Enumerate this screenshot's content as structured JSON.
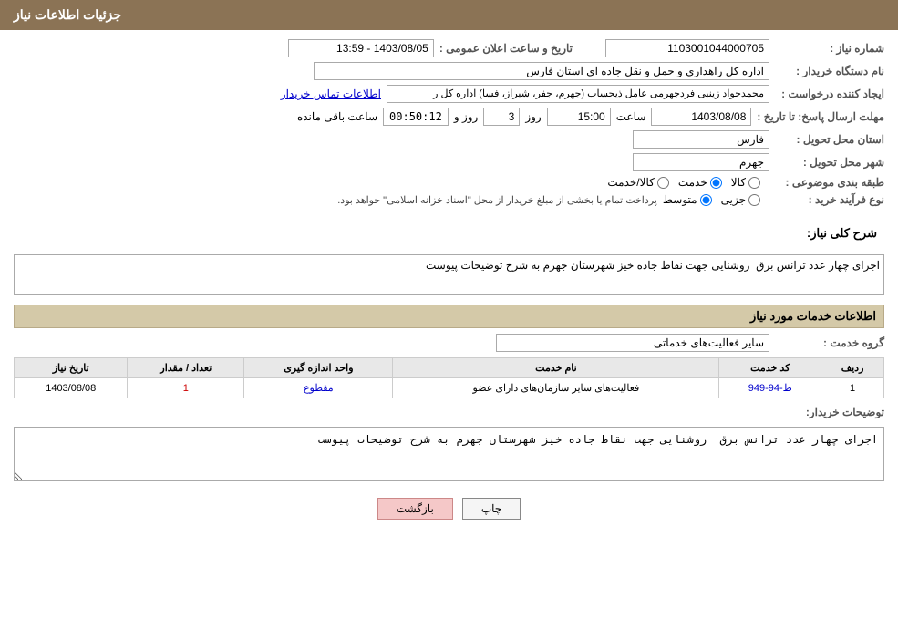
{
  "header": {
    "title": "جزئیات اطلاعات نیاز"
  },
  "form": {
    "shomareNiaz_label": "شماره نیاز :",
    "shomareNiaz_value": "1103001044000705",
    "namDastgah_label": "نام دستگاه خریدار :",
    "namDastgah_value": "اداره کل راهداری و حمل و نقل جاده ای استان فارس",
    "ijadKonande_label": "ایجاد کننده درخواست :",
    "ijadKonande_value": "محمدجواد زینبی فردجهرمی عامل ذیحساب (جهرم، جفر، شیراز، فسا) اداره کل ر",
    "ijadKonande_link": "اطلاعات تماس خریدار",
    "mohlat_label": "مهلت ارسال پاسخ: تا تاریخ :",
    "mohlat_date": "1403/08/08",
    "mohlat_time": "15:00",
    "mohlat_days": "3",
    "mohlat_remaining": "00:50:12",
    "mohlat_remaining_label": "روز و",
    "mohlat_remaining_suffix": "ساعت باقی مانده",
    "ostan_label": "استان محل تحویل :",
    "ostan_value": "فارس",
    "shahr_label": "شهر محل تحویل :",
    "shahr_value": "جهرم",
    "tabaqeBandi_label": "طبقه بندی موضوعی :",
    "tabaqe_options": [
      "کالا",
      "خدمت",
      "کالا/خدمت"
    ],
    "tabaqe_selected": "خدمت",
    "noeFarayand_label": "نوع فرآیند خرید :",
    "farayand_options": [
      "جزیی",
      "متوسط"
    ],
    "farayand_selected": "متوسط",
    "farayand_description": "پرداخت تمام یا بخشی از مبلغ خریدار از محل \"اسناد خزانه اسلامی\" خواهد بود.",
    "taarikheElam_label": "تاریخ و ساعت اعلان عمومی :",
    "taarikheElam_value": "1403/08/05 - 13:59",
    "sharh_section": "شرح کلی نیاز:",
    "sharh_value": "اجرای چهار عدد ترانس برق  روشنایی جهت نقاط جاده خیز شهرستان جهرم به شرح توضیحات پیوست",
    "services_section": "اطلاعات خدمات مورد نیاز",
    "groupeKhedmat_label": "گروه خدمت :",
    "groupeKhedmat_value": "سایر فعالیت‌های خدماتی",
    "table": {
      "headers": [
        "ردیف",
        "کد خدمت",
        "نام خدمت",
        "واحد اندازه گیری",
        "تعداد / مقدار",
        "تاریخ نیاز"
      ],
      "rows": [
        {
          "radif": "1",
          "code": "ط-94-949",
          "name": "فعالیت‌های سایر سازمان‌های دارای عضو",
          "unit": "مقطوع",
          "quantity": "1",
          "date": "1403/08/08"
        }
      ]
    },
    "tozihat_label": "توضیحات خریدار:",
    "tozihat_value": "اجرای چهار عدد ترانس برق  روشنایی جهت نقاط جاده خیز شهرستان جهرم به شرح توضیحات پیوست",
    "btn_print": "چاپ",
    "btn_back": "بازگشت"
  }
}
